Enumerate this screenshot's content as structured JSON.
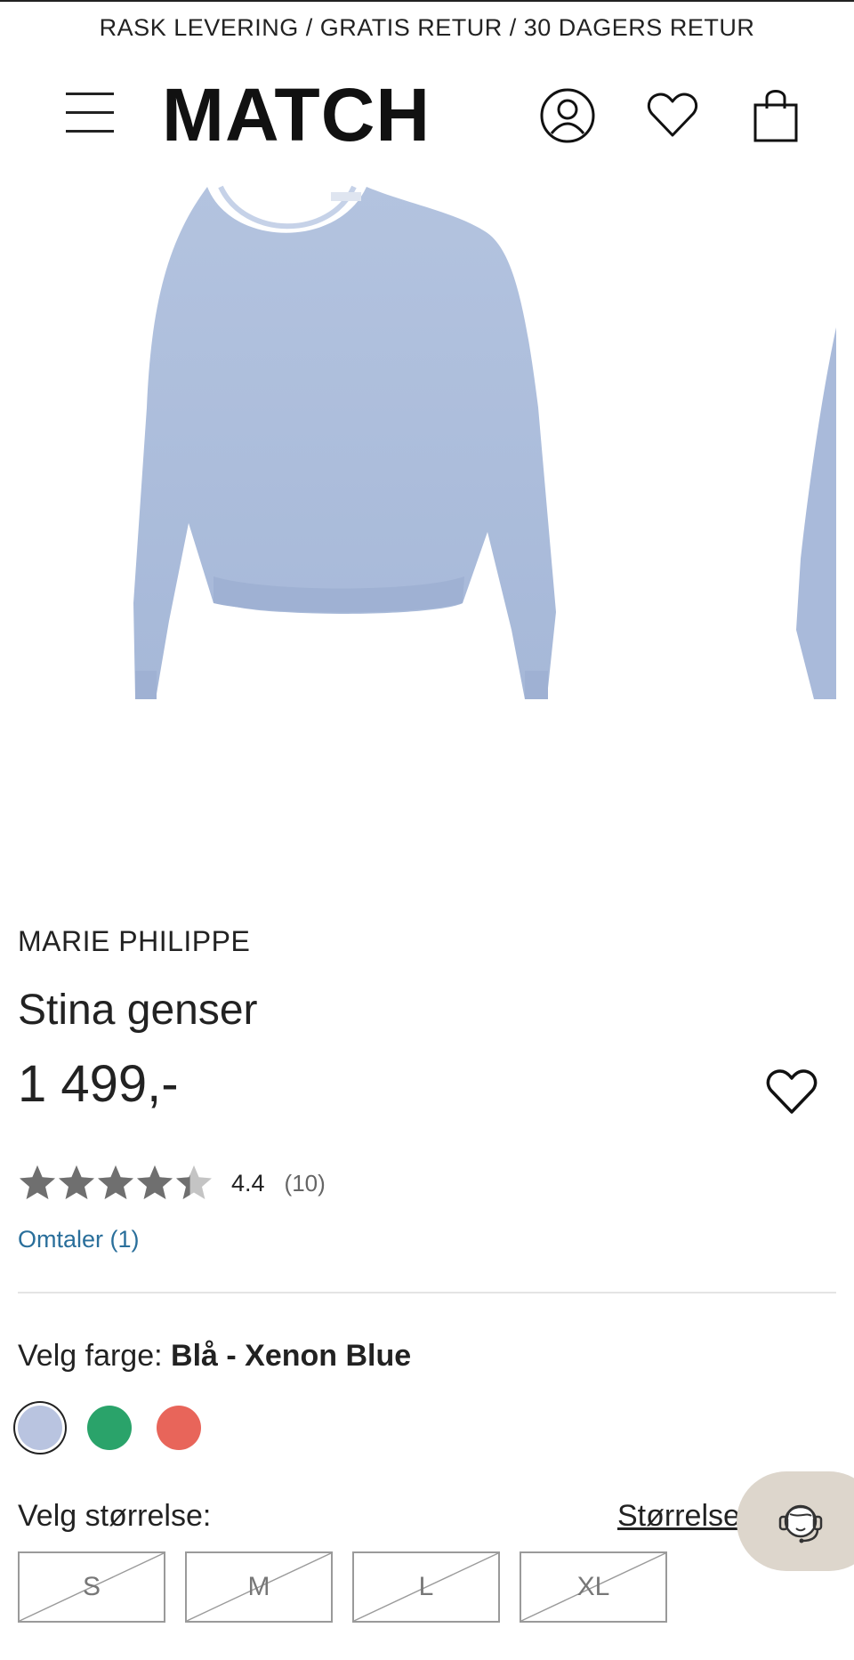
{
  "promo_bar": {
    "text": "RASK LEVERING / GRATIS RETUR / 30 DAGERS RETUR"
  },
  "header": {
    "logo": "MATCH",
    "icons": [
      "menu-icon",
      "user-icon",
      "heart-icon",
      "shopping-bag-icon"
    ]
  },
  "product": {
    "brand": "MARIE PHILIPPE",
    "name": "Stina genser",
    "price": "1 499,-",
    "rating": {
      "value": "4.4",
      "count": "(10)",
      "stars": 4.4,
      "max": 5
    },
    "reviews_link": "Omtaler (1)"
  },
  "color_picker": {
    "label": "Velg farge:",
    "selected": "Blå - Xenon Blue",
    "swatches": [
      {
        "name": "Blå - Xenon Blue",
        "hex": "#b9c4e0",
        "selected": true
      },
      {
        "name": "green",
        "hex": "#2aa36a",
        "selected": false
      },
      {
        "name": "red",
        "hex": "#e8655a",
        "selected": false
      }
    ]
  },
  "size_picker": {
    "label": "Velg størrelse:",
    "guide_link": "Størrelse",
    "sizes": [
      {
        "label": "S",
        "available": false
      },
      {
        "label": "M",
        "available": false
      },
      {
        "label": "L",
        "available": false
      },
      {
        "label": "XL",
        "available": false
      }
    ]
  },
  "colors": {
    "text": "#1c1c1c",
    "link": "#2a6f9b",
    "chat_bg": "#ddd6cc",
    "star": "#6f6f6f"
  }
}
